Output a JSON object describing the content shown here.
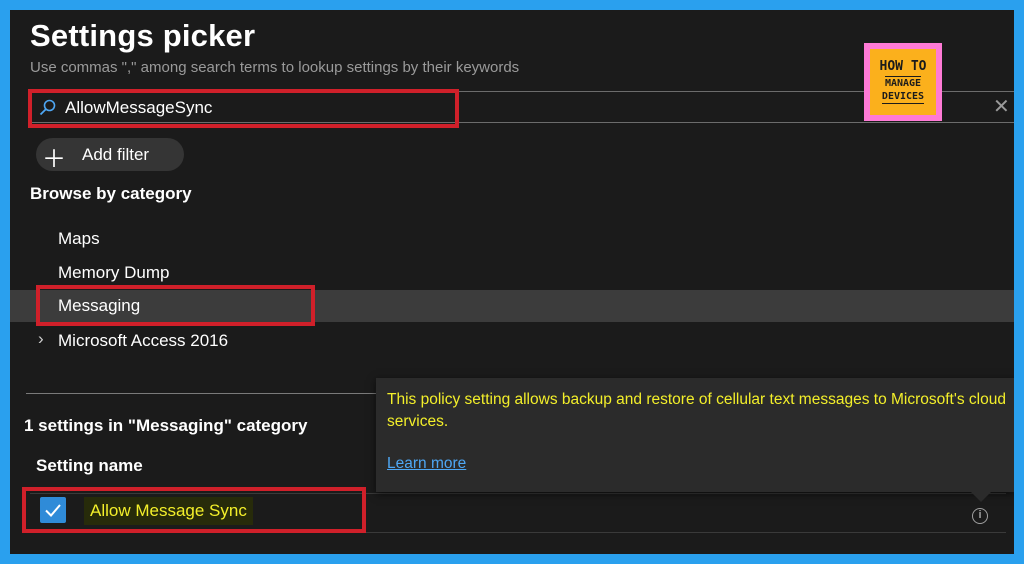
{
  "header": {
    "title": "Settings picker",
    "subtitle": "Use commas \",\" among search terms to lookup settings by their keywords"
  },
  "search": {
    "value": "AllowMessageSync",
    "icon": "search-icon",
    "clear_icon": "close-icon"
  },
  "logo": {
    "line1": "HOW TO",
    "line2": "MANAGE",
    "line3": "DEVICES"
  },
  "add_filter": {
    "label": "Add filter",
    "icon": "plus-icon"
  },
  "browse": {
    "heading": "Browse by category",
    "categories": [
      {
        "label": "Maps",
        "selected": false,
        "expandable": false
      },
      {
        "label": "Memory Dump",
        "selected": false,
        "expandable": false
      },
      {
        "label": "Messaging",
        "selected": true,
        "expandable": false
      },
      {
        "label": "Microsoft Access 2016",
        "selected": false,
        "expandable": true
      }
    ]
  },
  "results": {
    "count_text": "1 settings in \"Messaging\" category",
    "column_header": "Setting name",
    "rows": [
      {
        "label": "Allow Message Sync",
        "checked": true
      }
    ]
  },
  "tooltip": {
    "description": "This policy setting allows backup and restore of cellular text messages to Microsoft's cloud services.",
    "link": "Learn more"
  },
  "colors": {
    "frame": "#2aa0ee",
    "background": "#1b1b1b",
    "highlight_box": "#d0202a",
    "accent": "#2f8bd8",
    "highlight_text": "#f3ef2a",
    "link": "#4ea7f4"
  }
}
